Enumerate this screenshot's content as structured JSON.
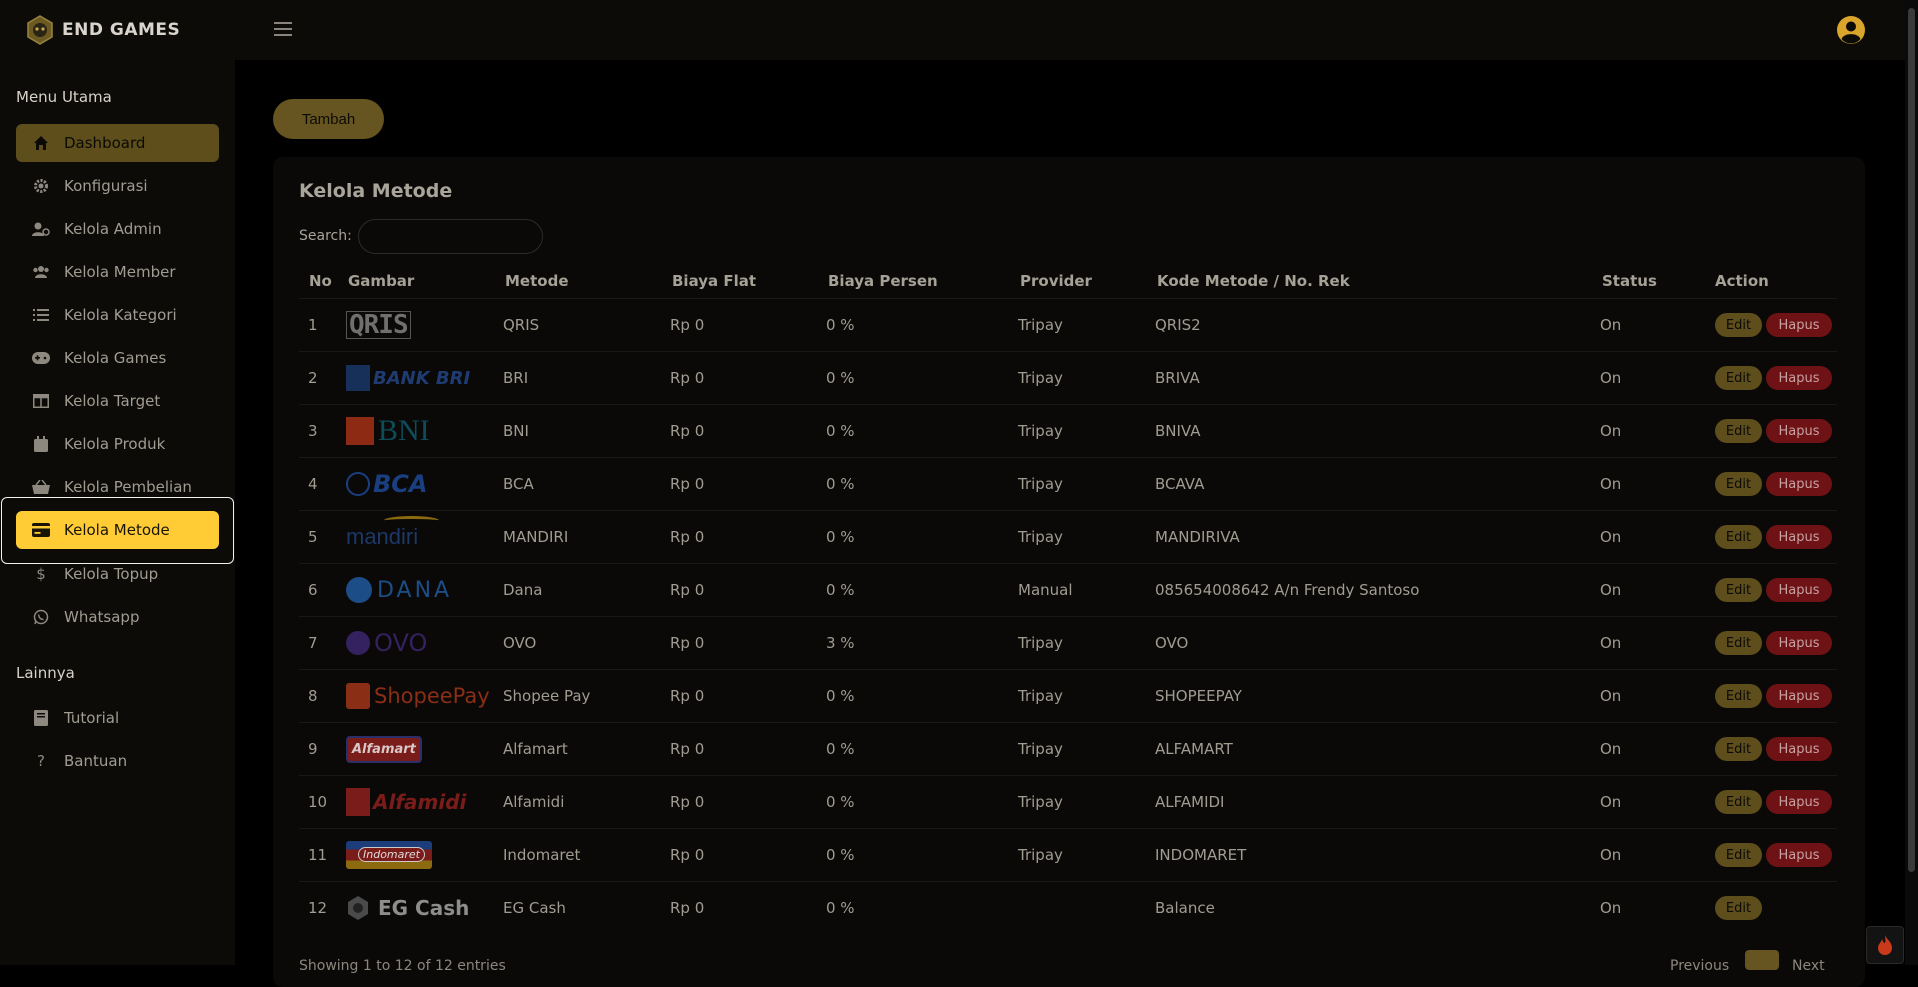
{
  "app": {
    "brand": "END GAMES"
  },
  "sidebar": {
    "section_main": "Menu Utama",
    "section_other": "Lainnya",
    "items": [
      {
        "label": "Dashboard",
        "icon": "home-icon"
      },
      {
        "label": "Konfigurasi",
        "icon": "gear-icon"
      },
      {
        "label": "Kelola Admin",
        "icon": "user-cog-icon"
      },
      {
        "label": "Kelola Member",
        "icon": "users-icon"
      },
      {
        "label": "Kelola Kategori",
        "icon": "list-icon"
      },
      {
        "label": "Kelola Games",
        "icon": "gamepad-icon"
      },
      {
        "label": "Kelola Target",
        "icon": "table-icon"
      },
      {
        "label": "Kelola Produk",
        "icon": "calendar-icon"
      },
      {
        "label": "Kelola Pembelian",
        "icon": "basket-icon"
      },
      {
        "label": "Kelola Metode",
        "icon": "credit-card-icon"
      },
      {
        "label": "Kelola Topup",
        "icon": "dollar-icon"
      },
      {
        "label": "Whatsapp",
        "icon": "whatsapp-icon"
      }
    ],
    "other_items": [
      {
        "label": "Tutorial",
        "icon": "book-icon"
      },
      {
        "label": "Bantuan",
        "icon": "question-icon"
      }
    ]
  },
  "toolbar": {
    "add_label": "Tambah"
  },
  "card": {
    "title": "Kelola Metode",
    "search_label": "Search:",
    "search_value": ""
  },
  "table": {
    "headers": [
      "No",
      "Gambar",
      "Metode",
      "Biaya Flat",
      "Biaya Persen",
      "Provider",
      "Kode Metode / No. Rek",
      "Status",
      "Action"
    ],
    "edit_label": "Edit",
    "delete_label": "Hapus",
    "rows": [
      {
        "no": "1",
        "logo": "QRIS",
        "metode": "QRIS",
        "flat": "Rp 0",
        "persen": "0 %",
        "provider": "Tripay",
        "kode": "QRIS2",
        "status": "On",
        "can_delete": true
      },
      {
        "no": "2",
        "logo": "BANK BRI",
        "metode": "BRI",
        "flat": "Rp 0",
        "persen": "0 %",
        "provider": "Tripay",
        "kode": "BRIVA",
        "status": "On",
        "can_delete": true
      },
      {
        "no": "3",
        "logo": "BNI",
        "metode": "BNI",
        "flat": "Rp 0",
        "persen": "0 %",
        "provider": "Tripay",
        "kode": "BNIVA",
        "status": "On",
        "can_delete": true
      },
      {
        "no": "4",
        "logo": "BCA",
        "metode": "BCA",
        "flat": "Rp 0",
        "persen": "0 %",
        "provider": "Tripay",
        "kode": "BCAVA",
        "status": "On",
        "can_delete": true
      },
      {
        "no": "5",
        "logo": "mandiri",
        "metode": "MANDIRI",
        "flat": "Rp 0",
        "persen": "0 %",
        "provider": "Tripay",
        "kode": "MANDIRIVA",
        "status": "On",
        "can_delete": true
      },
      {
        "no": "6",
        "logo": "DANA",
        "metode": "Dana",
        "flat": "Rp 0",
        "persen": "0 %",
        "provider": "Manual",
        "kode": "085654008642 A/n Frendy Santoso",
        "status": "On",
        "can_delete": true
      },
      {
        "no": "7",
        "logo": "OVO",
        "metode": "OVO",
        "flat": "Rp 0",
        "persen": "3 %",
        "provider": "Tripay",
        "kode": "OVO",
        "status": "On",
        "can_delete": true
      },
      {
        "no": "8",
        "logo": "ShopeePay",
        "metode": "Shopee Pay",
        "flat": "Rp 0",
        "persen": "0 %",
        "provider": "Tripay",
        "kode": "SHOPEEPAY",
        "status": "On",
        "can_delete": true
      },
      {
        "no": "9",
        "logo": "Alfamart",
        "metode": "Alfamart",
        "flat": "Rp 0",
        "persen": "0 %",
        "provider": "Tripay",
        "kode": "ALFAMART",
        "status": "On",
        "can_delete": true
      },
      {
        "no": "10",
        "logo": "Alfamidi",
        "metode": "Alfamidi",
        "flat": "Rp 0",
        "persen": "0 %",
        "provider": "Tripay",
        "kode": "ALFAMIDI",
        "status": "On",
        "can_delete": true
      },
      {
        "no": "11",
        "logo": "Indomaret",
        "metode": "Indomaret",
        "flat": "Rp 0",
        "persen": "0 %",
        "provider": "Tripay",
        "kode": "INDOMARET",
        "status": "On",
        "can_delete": true
      },
      {
        "no": "12",
        "logo": "EG Cash",
        "metode": "EG Cash",
        "flat": "Rp 0",
        "persen": "0 %",
        "provider": "",
        "kode": "Balance",
        "status": "On",
        "can_delete": false
      }
    ]
  },
  "footer": {
    "info": "Showing 1 to 12 of 12 entries",
    "previous": "Previous",
    "page": "1",
    "next": "Next"
  },
  "colors": {
    "accent": "#ffcc35",
    "accent_dim": "#5d4e1b",
    "danger_dim": "#6e1216",
    "background": "#000000",
    "sidebar": "#0c0b08"
  }
}
